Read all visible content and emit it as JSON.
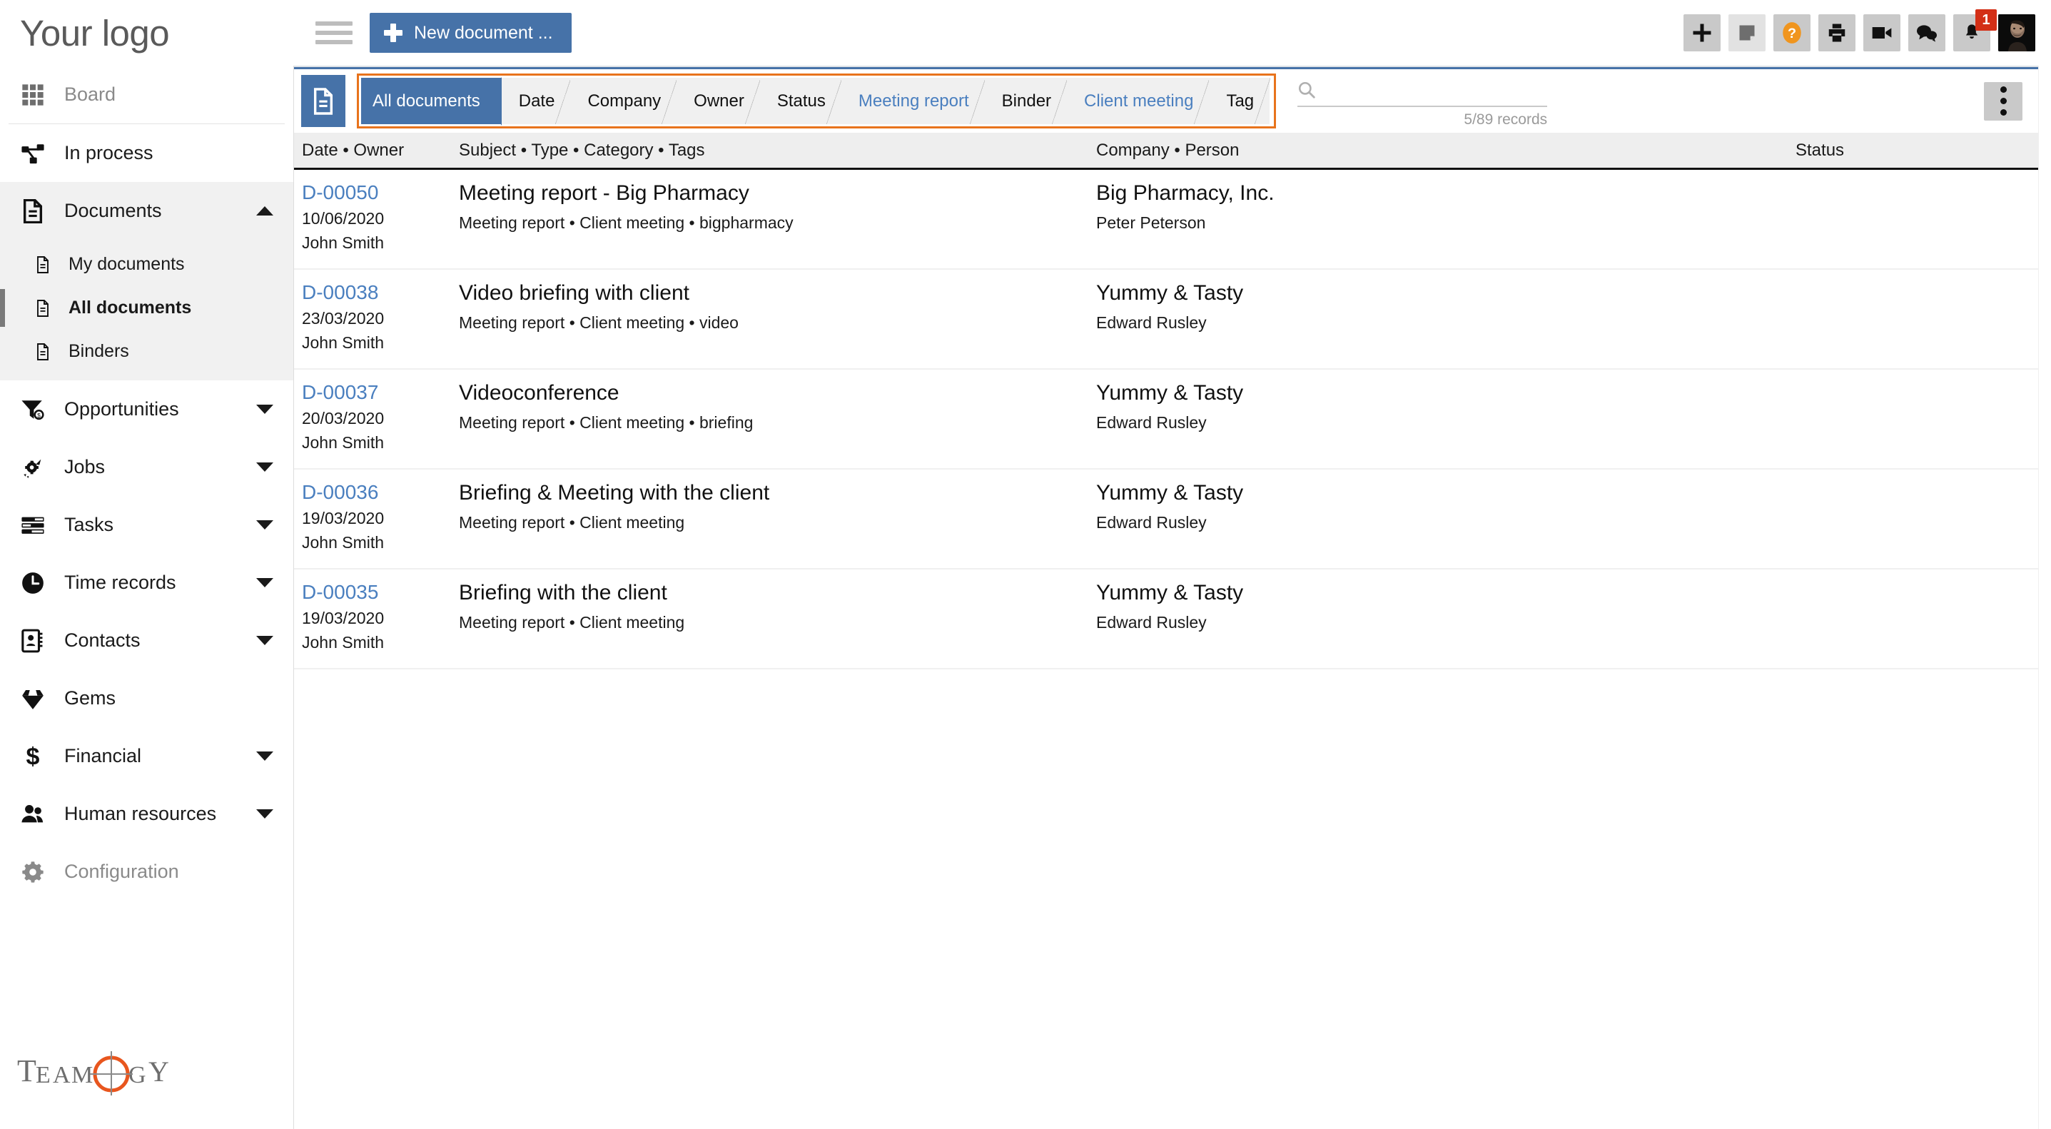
{
  "brand": {
    "logo_text": "Your logo",
    "footer_logo_text": "TEAMOGY",
    "accent_blue": "#4672a8",
    "accent_orange": "#e8731c",
    "link_blue": "#4a7fbf",
    "badge_red": "#d32f16"
  },
  "topbar": {
    "menu_icon": "hamburger-icon",
    "new_document_label": "New document ...",
    "icons": [
      {
        "name": "add-icon",
        "glyph": "plus"
      },
      {
        "name": "note-icon",
        "glyph": "note"
      },
      {
        "name": "help-icon",
        "glyph": "question"
      },
      {
        "name": "print-icon",
        "glyph": "printer"
      },
      {
        "name": "video-icon",
        "glyph": "videocamera"
      },
      {
        "name": "chat-icon",
        "glyph": "speech-bubbles"
      },
      {
        "name": "notifications-icon",
        "glyph": "bell",
        "badge": "1"
      },
      {
        "name": "avatar",
        "glyph": "user-photo"
      }
    ]
  },
  "sidebar": {
    "items": [
      {
        "label": "Board",
        "icon": "grid-icon",
        "muted": true,
        "expandable": false,
        "expanded": false
      },
      {
        "label": "In process",
        "icon": "workflow-icon",
        "muted": false,
        "expandable": false,
        "expanded": false
      },
      {
        "label": "Documents",
        "icon": "document-icon",
        "muted": false,
        "expandable": true,
        "expanded": true
      },
      {
        "label": "Opportunities",
        "icon": "funnel-coin-icon",
        "muted": false,
        "expandable": true,
        "expanded": false
      },
      {
        "label": "Jobs",
        "icon": "rocket-gear-icon",
        "muted": false,
        "expandable": true,
        "expanded": false
      },
      {
        "label": "Tasks",
        "icon": "tasks-icon",
        "muted": false,
        "expandable": true,
        "expanded": false
      },
      {
        "label": "Time records",
        "icon": "clock-icon",
        "muted": false,
        "expandable": true,
        "expanded": false
      },
      {
        "label": "Contacts",
        "icon": "contacts-icon",
        "muted": false,
        "expandable": true,
        "expanded": false
      },
      {
        "label": "Gems",
        "icon": "gem-icon",
        "muted": false,
        "expandable": false,
        "expanded": false
      },
      {
        "label": "Financial",
        "icon": "dollar-icon",
        "muted": false,
        "expandable": true,
        "expanded": false
      },
      {
        "label": "Human resources",
        "icon": "people-icon",
        "muted": false,
        "expandable": true,
        "expanded": false
      },
      {
        "label": "Configuration",
        "icon": "gear-icon",
        "muted": true,
        "expandable": false,
        "expanded": false
      }
    ],
    "documents_subitems": [
      {
        "label": "My documents",
        "selected": false
      },
      {
        "label": "All documents",
        "selected": true
      },
      {
        "label": "Binders",
        "selected": false
      }
    ]
  },
  "filterbar": {
    "section_icon": "document-icon",
    "breadcrumbs": [
      {
        "label": "All documents",
        "state": "current"
      },
      {
        "label": "Date",
        "state": "normal"
      },
      {
        "label": "Company",
        "state": "normal"
      },
      {
        "label": "Owner",
        "state": "normal"
      },
      {
        "label": "Status",
        "state": "normal"
      },
      {
        "label": "Meeting report",
        "state": "active"
      },
      {
        "label": "Binder",
        "state": "normal"
      },
      {
        "label": "Client meeting",
        "state": "active"
      },
      {
        "label": "Tag",
        "state": "normal"
      }
    ],
    "search": {
      "value": "",
      "placeholder": "",
      "icon": "search-icon"
    },
    "records_count": "5/89 records",
    "more_menu_icon": "kebab-menu-icon"
  },
  "table": {
    "columns": [
      {
        "key": "date",
        "label": "Date • Owner"
      },
      {
        "key": "subject",
        "label": "Subject • Type • Category • Tags"
      },
      {
        "key": "company",
        "label": "Company • Person"
      },
      {
        "key": "status",
        "label": "Status"
      }
    ],
    "rows": [
      {
        "doc_id": "D-00050",
        "date": "10/06/2020",
        "owner": "John Smith",
        "subject": "Meeting report - Big Pharmacy",
        "tags": "Meeting report • Client meeting • bigpharmacy",
        "company": "Big Pharmacy, Inc.",
        "person": "Peter Peterson",
        "status": ""
      },
      {
        "doc_id": "D-00038",
        "date": "23/03/2020",
        "owner": "John Smith",
        "subject": "Video briefing with client",
        "tags": "Meeting report • Client meeting • video",
        "company": "Yummy & Tasty",
        "person": "Edward Rusley",
        "status": ""
      },
      {
        "doc_id": "D-00037",
        "date": "20/03/2020",
        "owner": "John Smith",
        "subject": "Videoconference",
        "tags": "Meeting report • Client meeting • briefing",
        "company": "Yummy & Tasty",
        "person": "Edward Rusley",
        "status": ""
      },
      {
        "doc_id": "D-00036",
        "date": "19/03/2020",
        "owner": "John Smith",
        "subject": "Briefing & Meeting with the client",
        "tags": "Meeting report • Client meeting",
        "company": "Yummy & Tasty",
        "person": "Edward Rusley",
        "status": ""
      },
      {
        "doc_id": "D-00035",
        "date": "19/03/2020",
        "owner": "John Smith",
        "subject": "Briefing with the client",
        "tags": "Meeting report • Client meeting",
        "company": "Yummy & Tasty",
        "person": "Edward Rusley",
        "status": ""
      }
    ]
  }
}
